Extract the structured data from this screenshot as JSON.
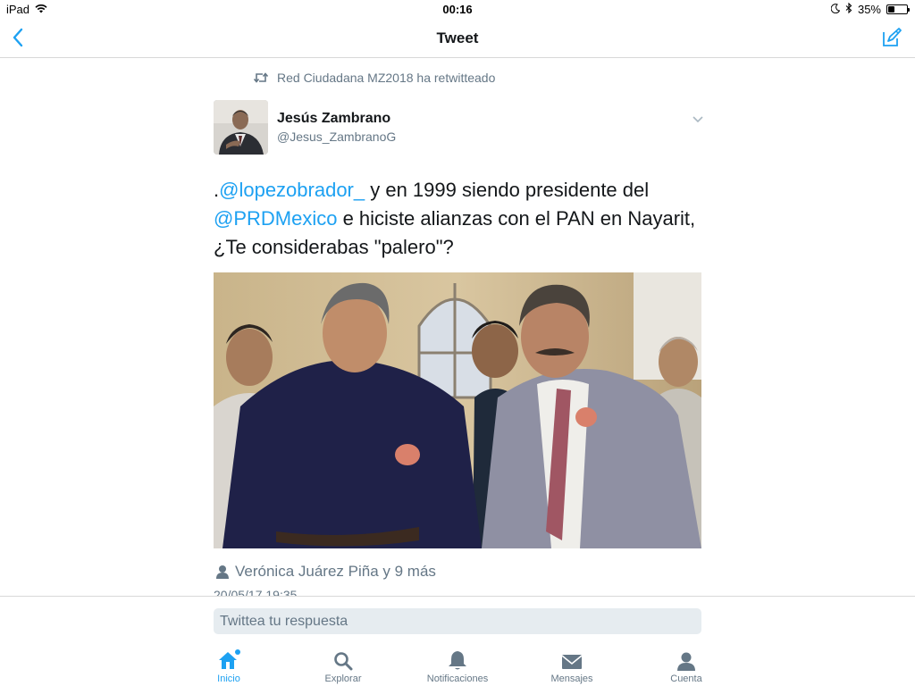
{
  "status_bar": {
    "device": "iPad",
    "time": "00:16",
    "battery_text": "35%",
    "battery_level": 0.35
  },
  "nav": {
    "title": "Tweet"
  },
  "tweet": {
    "retweeted_by": "Red Ciudadana MZ2018 ha retwitteado",
    "author_name": "Jesús Zambrano",
    "author_handle": "@Jesus_ZambranoG",
    "text_prefix": ".",
    "mention1": "@lopezobrador_",
    "text_mid": " y en 1999 siendo presidente del ",
    "mention2": "@PRDMexico",
    "text_end": " e hiciste alianzas con el PAN en Nayarit, ¿Te considerabas \"palero\"?",
    "likers": "Verónica Juárez Piña y 9 más",
    "timestamp": "20/05/17 19:35"
  },
  "reply": {
    "placeholder": "Twittea tu respuesta"
  },
  "tabs": [
    {
      "label": "Inicio",
      "icon": "home-icon",
      "active": true
    },
    {
      "label": "Explorar",
      "icon": "search-icon",
      "active": false
    },
    {
      "label": "Notificaciones",
      "icon": "bell-icon",
      "active": false
    },
    {
      "label": "Mensajes",
      "icon": "envelope-icon",
      "active": false
    },
    {
      "label": "Cuenta",
      "icon": "person-icon",
      "active": false
    }
  ],
  "colors": {
    "accent": "#1da1f2",
    "secondary_text": "#657786",
    "input_bg": "#e6ecf0"
  }
}
